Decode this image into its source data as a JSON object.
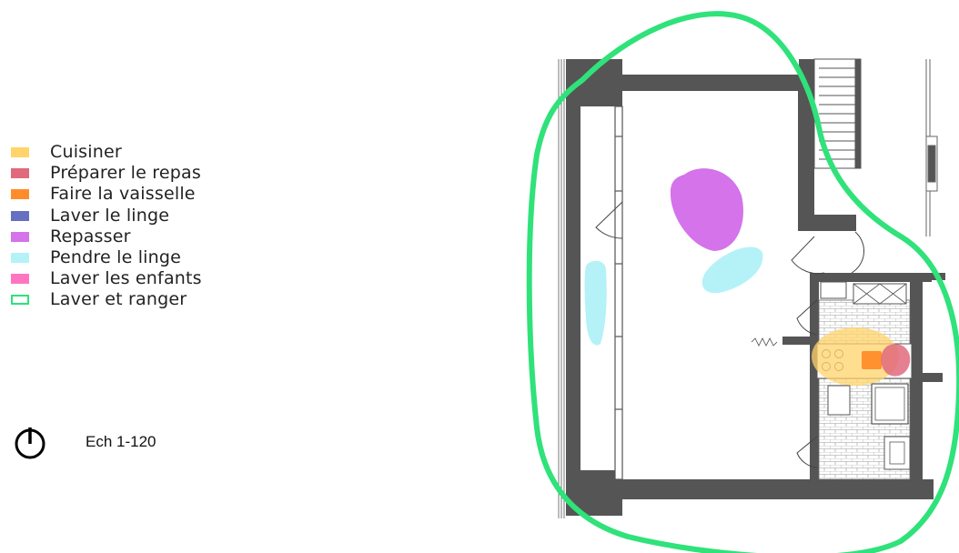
{
  "legend": {
    "items": [
      {
        "label": "Cuisiner",
        "color": "#ffd46a",
        "style": "fill"
      },
      {
        "label": "Préparer le repas",
        "color": "#e06a7c",
        "style": "fill"
      },
      {
        "label": "Faire la vaisselle",
        "color": "#ff8c2a",
        "style": "fill"
      },
      {
        "label": "Laver le linge",
        "color": "#6670c2",
        "style": "fill"
      },
      {
        "label": "Repasser",
        "color": "#d473ea",
        "style": "fill"
      },
      {
        "label": "Pendre le linge",
        "color": "#b4f2f8",
        "style": "fill"
      },
      {
        "label": "Laver les enfants",
        "color": "#ff76c0",
        "style": "fill"
      },
      {
        "label": "Laver et ranger",
        "color": "#2fe27a",
        "style": "outline"
      }
    ]
  },
  "north_icon": "north-arrow-icon",
  "scale": {
    "label": "Ech 1-120"
  },
  "plan": {
    "wall_color": "#555555",
    "zones": {
      "cuisiner": "#ffd46a",
      "preparer": "#e06a7c",
      "vaisselle": "#ff8c2a",
      "repasser": "#d473ea",
      "pendre": "#b4f2f8",
      "laver_ranger": "#2fe27a"
    }
  }
}
